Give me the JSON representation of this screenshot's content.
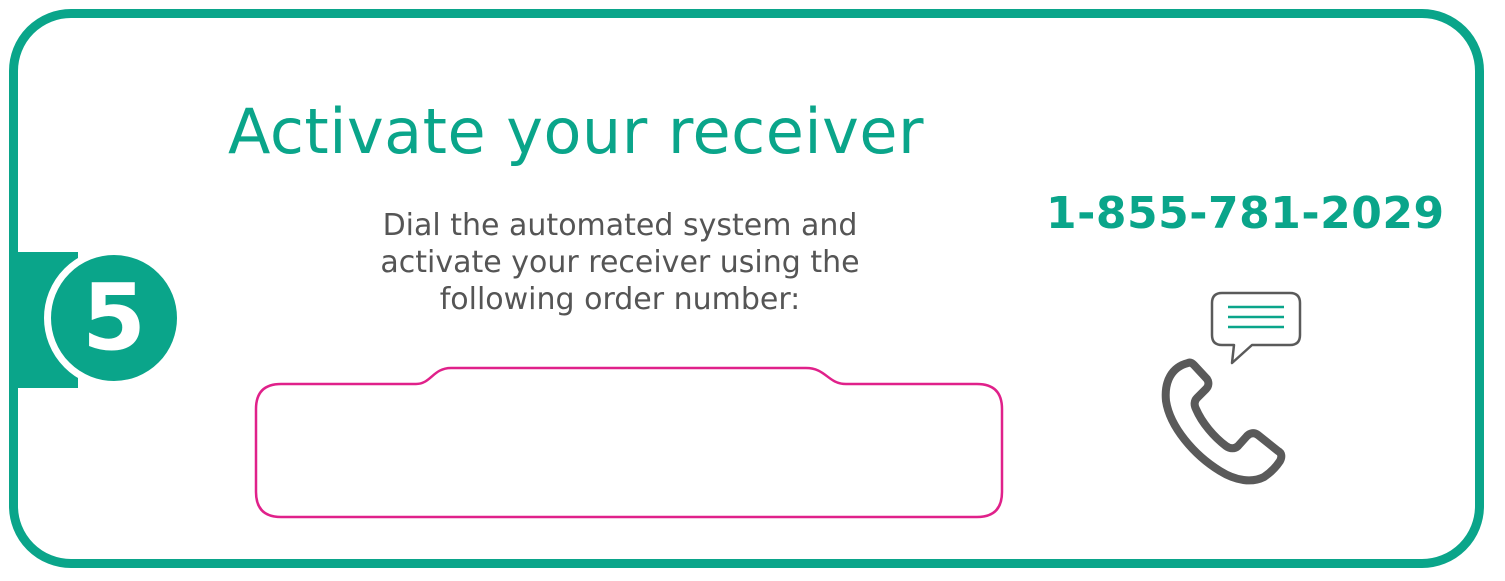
{
  "card": {
    "title": "Activate your receiver",
    "step_number": "5",
    "instructions": "Dial the automated system and activate your receiver using the following order number:",
    "order_number": {
      "value": "",
      "placeholder": ""
    },
    "phone_number": "1-855-781-2029"
  },
  "icons": {
    "phone": "phone-icon",
    "chat": "chat-bubble-icon"
  },
  "colors": {
    "accent": "#0aa58a",
    "order_box_border": "#e0218a",
    "body_text": "#555555",
    "icon_stroke": "#5a5a5a"
  }
}
